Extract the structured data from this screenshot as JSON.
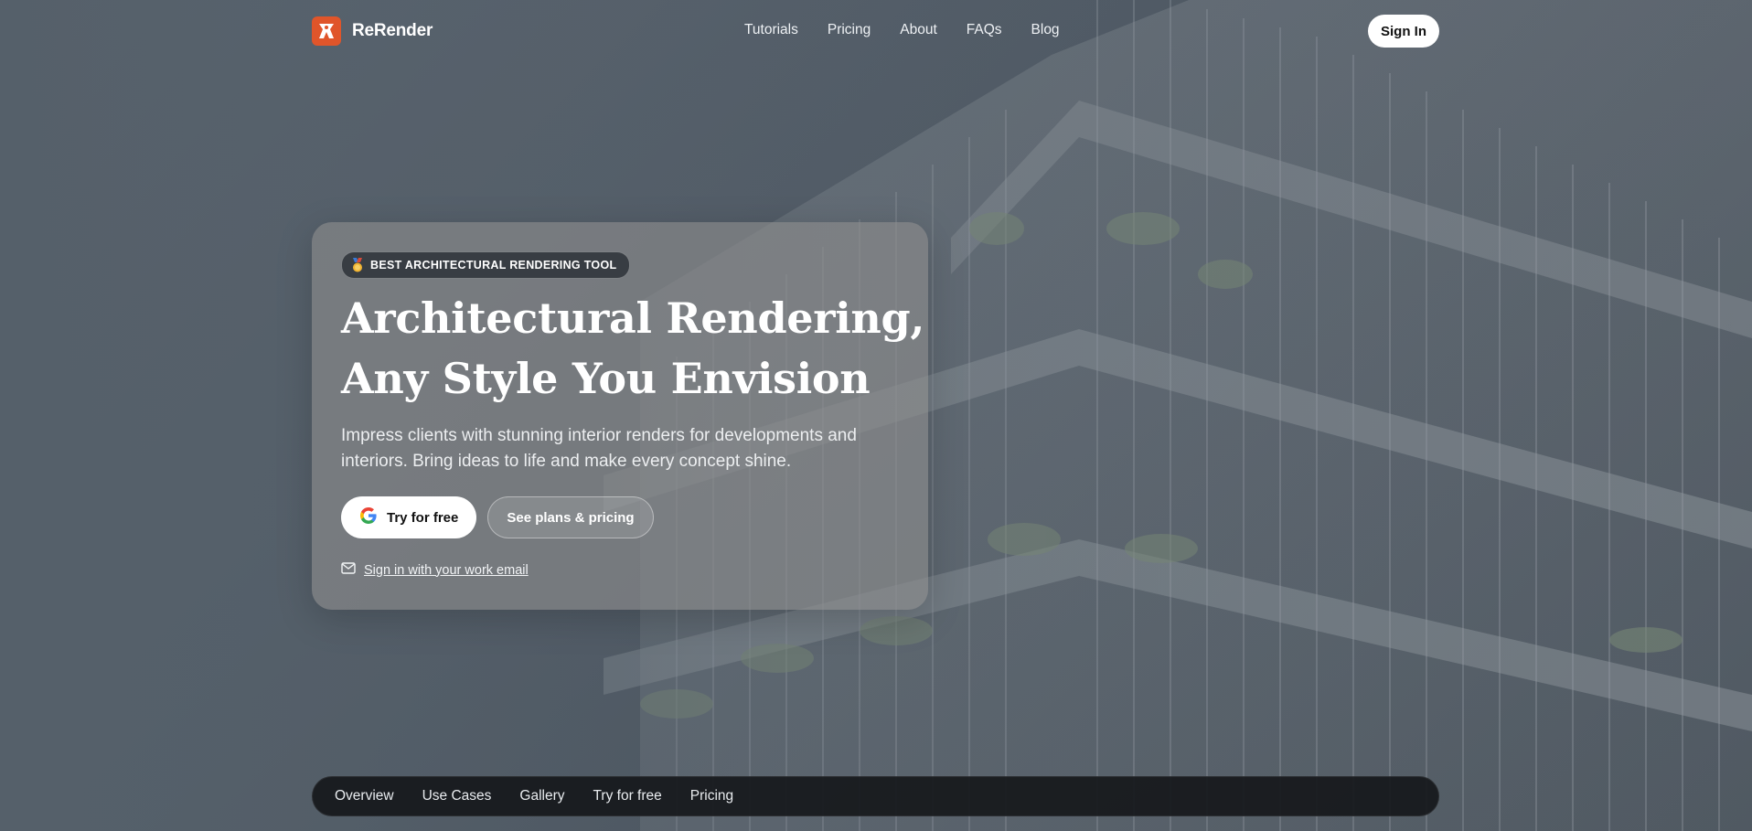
{
  "brand": {
    "name": "ReRender",
    "logo_icon": "rerender-logo-icon",
    "logo_color": "#e0552a"
  },
  "nav": {
    "links": [
      "Tutorials",
      "Pricing",
      "About",
      "FAQs",
      "Blog"
    ],
    "sign_in_label": "Sign In"
  },
  "hero": {
    "badge_icon": "medal-icon",
    "badge_text": "BEST ARCHITECTURAL RENDERING TOOL",
    "title_line1": "Architectural Rendering,",
    "title_line2": "Any Style You Envision",
    "subtitle": "Impress clients with stunning interior renders for developments and interiors. Bring ideas to life and make every concept shine.",
    "primary_cta": {
      "icon": "google-icon",
      "label": "Try for free"
    },
    "secondary_cta": {
      "label": "See plans & pricing"
    },
    "email_link": {
      "icon": "mail-icon",
      "label": "Sign in with your work email"
    }
  },
  "section_nav": {
    "links": [
      "Overview",
      "Use Cases",
      "Gallery",
      "Try for free",
      "Pricing"
    ]
  },
  "colors": {
    "accent": "#e0552a",
    "background": "#56606b",
    "card": "#8c8c8c",
    "section_nav": "#16181b"
  }
}
